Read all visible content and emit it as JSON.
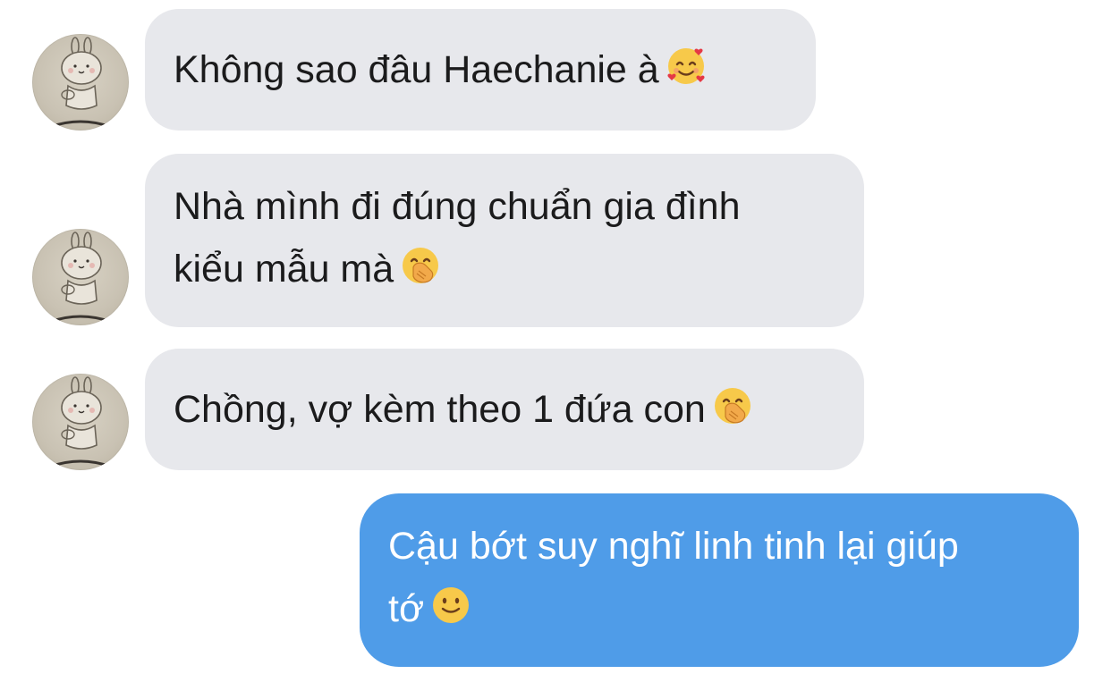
{
  "conversation": {
    "messages": [
      {
        "direction": "incoming",
        "lines": [
          "Không sao đâu Haechanie à"
        ],
        "emoji": "smiling-face-with-hearts-icon"
      },
      {
        "direction": "incoming",
        "lines": [
          "Nhà mình đi đúng chuẩn gia đình",
          "kiểu mẫu mà"
        ],
        "emoji": "hand-over-mouth-icon"
      },
      {
        "direction": "incoming",
        "lines": [
          "Chồng, vợ kèm theo 1 đứa con"
        ],
        "emoji": "hand-over-mouth-icon"
      },
      {
        "direction": "outgoing",
        "lines": [
          "Cậu bớt suy nghĩ linh tinh lại giúp",
          "tớ"
        ],
        "emoji": "slightly-smiling-face-icon"
      }
    ],
    "avatar_icon": "bunny-sticker-avatar",
    "colors": {
      "incoming_bubble": "#e7e8ec",
      "outgoing_bubble": "#4f9ce8",
      "incoming_text": "#1b1b1c",
      "outgoing_text": "#ffffff"
    }
  }
}
